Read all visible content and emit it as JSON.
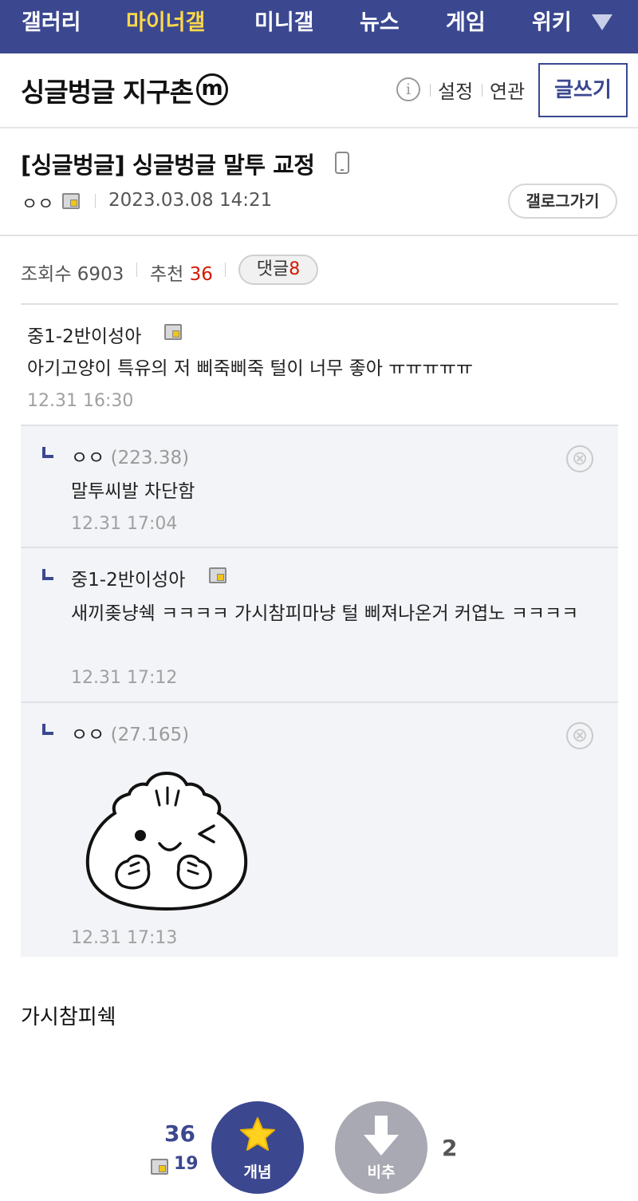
{
  "nav": {
    "items": [
      "갤러리",
      "마이너갤",
      "미니갤",
      "뉴스",
      "게임",
      "위키"
    ],
    "active_index": 1,
    "more_icon": "triangle-down-icon"
  },
  "gallery": {
    "title": "싱글벙글 지구촌",
    "badge": "m",
    "info_icon": "i",
    "settings_label": "설정",
    "related_label": "연관",
    "write_label": "글쓰기"
  },
  "post": {
    "title": "[싱글벙글] 싱글벙글 말투 교정",
    "writer": "ㅇㅇ",
    "date": "2023.03.08 14:21",
    "gallog_label": "갤로그가기",
    "views_label": "조회수",
    "views": "6903",
    "recommend_label": "추천",
    "recommend": "36",
    "comments_label": "댓글",
    "comments": "8",
    "body": "가시참피쉑"
  },
  "comments": [
    {
      "nick": "중1-2반이성아",
      "ip": "",
      "text": "아기고양이 특유의 저 삐죽삐죽 털이 너무 좋아 ㅠㅠㅠㅠㅠ",
      "date": "12.31 16:30"
    },
    {
      "nick": "ㅇㅇ",
      "ip": "(223.38)",
      "text": "말투씨발 차단함",
      "date": "12.31 17:04"
    },
    {
      "nick": "중1-2반이성아",
      "ip": "",
      "text": "새끼좆냥쉑 ㅋㅋㅋㅋ 가시참피마냥 털 삐져나온거 커엽노 ㅋㅋㅋㅋ",
      "date": "12.31 17:12"
    },
    {
      "nick": "ㅇㅇ",
      "ip": "(27.165)",
      "text": "",
      "date": "12.31 17:13"
    }
  ],
  "delete_icon": "⊗",
  "vote": {
    "up_count": "36",
    "up_fixed_count": "19",
    "up_label": "개념",
    "down_label": "비추",
    "down_count": "2"
  },
  "colors": {
    "brand": "#3b4890",
    "active_nav": "#ffd84a",
    "count_red": "#d31900",
    "reply_bg": "#f3f4f7"
  }
}
